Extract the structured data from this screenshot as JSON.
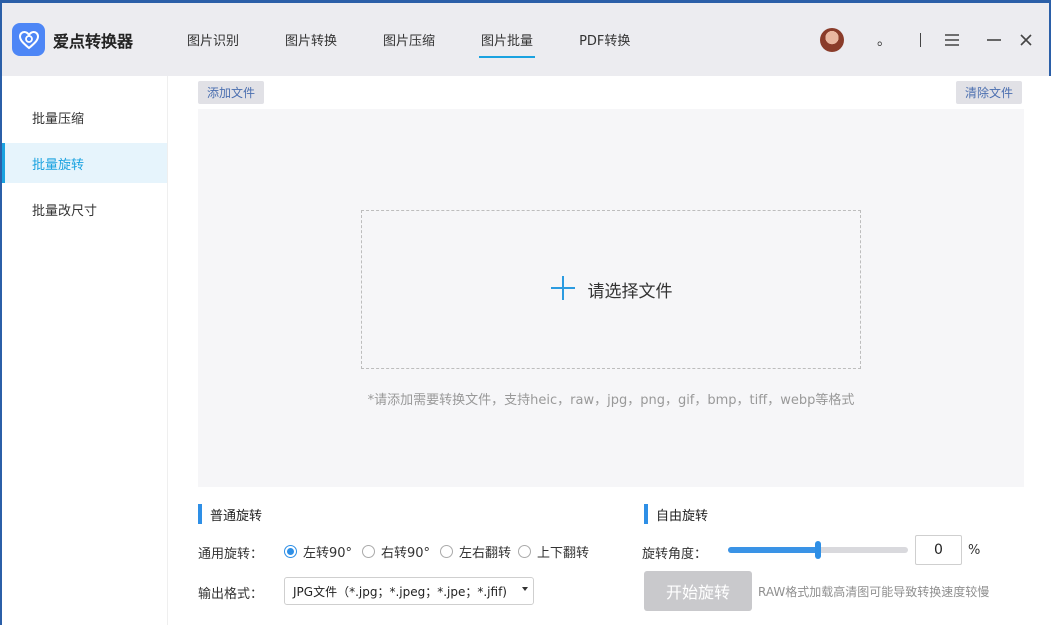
{
  "app": {
    "title": "爱点转换器"
  },
  "nav": {
    "tabs": [
      {
        "label": "图片识别"
      },
      {
        "label": "图片转换"
      },
      {
        "label": "图片压缩"
      },
      {
        "label": "图片批量",
        "active": true
      },
      {
        "label": "PDF转换"
      }
    ]
  },
  "header": {
    "dot": "。"
  },
  "sidebar": {
    "items": [
      {
        "label": "批量压缩"
      },
      {
        "label": "批量旋转",
        "active": true
      },
      {
        "label": "批量改尺寸"
      }
    ]
  },
  "toolbar": {
    "add_label": "添加文件",
    "clear_label": "清除文件"
  },
  "drop": {
    "label": "请选择文件",
    "hint": "*请添加需要转换文件，支持heic，raw，jpg，png，gif，bmp，tiff，webp等格式"
  },
  "normal_rotate": {
    "title": "普通旋转",
    "rotate_label": "通用旋转：",
    "options": [
      "左转90°",
      "右转90°",
      "左右翻转",
      "上下翻转"
    ],
    "selected": 0,
    "format_label": "输出格式：",
    "format_value": "JPG文件（*.jpg；*.jpeg；*.jpe；*.jfif)"
  },
  "free_rotate": {
    "title": "自由旋转",
    "angle_label": "旋转角度：",
    "slider_fraction": 0.5,
    "angle_value": "0",
    "unit": "%",
    "start_label": "开始旋转",
    "note": "RAW格式加载高清图可能导致转换速度较慢"
  },
  "colors": {
    "accent": "#1aa2e0",
    "slider": "#2e8fe6",
    "button_disabled": "#c9c9cc"
  },
  "icons": [
    "app-logo-icon",
    "menu-icon",
    "minimize-icon",
    "close-icon",
    "plus-icon"
  ]
}
